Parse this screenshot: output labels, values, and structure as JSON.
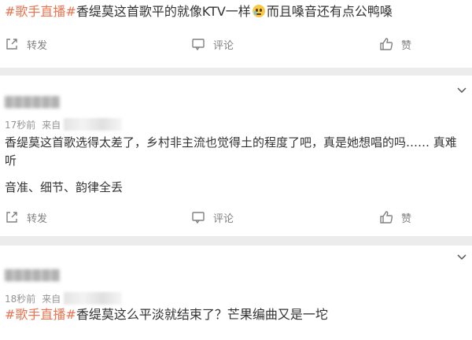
{
  "colors": {
    "hashtag": "#eb7350",
    "text": "#333333",
    "meta": "#939393",
    "action": "#808080",
    "background": "#ececec"
  },
  "post1": {
    "hashtag": "#歌手直播#",
    "text_before_emoji": "香缇莫这首歌平的就像KTV一样",
    "emoji": "crying-face",
    "text_after_emoji": "而且嗓音还有点公鸭嗓",
    "actions": {
      "repost": "转发",
      "comment": "评论",
      "like": "赞"
    }
  },
  "comment1": {
    "time": "17秒前",
    "source_label": "来自",
    "line1": "香缇莫这首歌选得太差了，乡村非主流也觉得土的程度了吧，真是她想唱的吗…… 真难",
    "line2": "听",
    "line3": "音准、细节、韵律全丢",
    "actions": {
      "repost": "转发",
      "comment": "评论",
      "like": "赞"
    }
  },
  "comment2": {
    "time": "18秒前",
    "source_label": "来自",
    "hashtag": "#歌手直播#",
    "text": "香缇莫这么平淡就结束了？芒果编曲又是一坨"
  }
}
